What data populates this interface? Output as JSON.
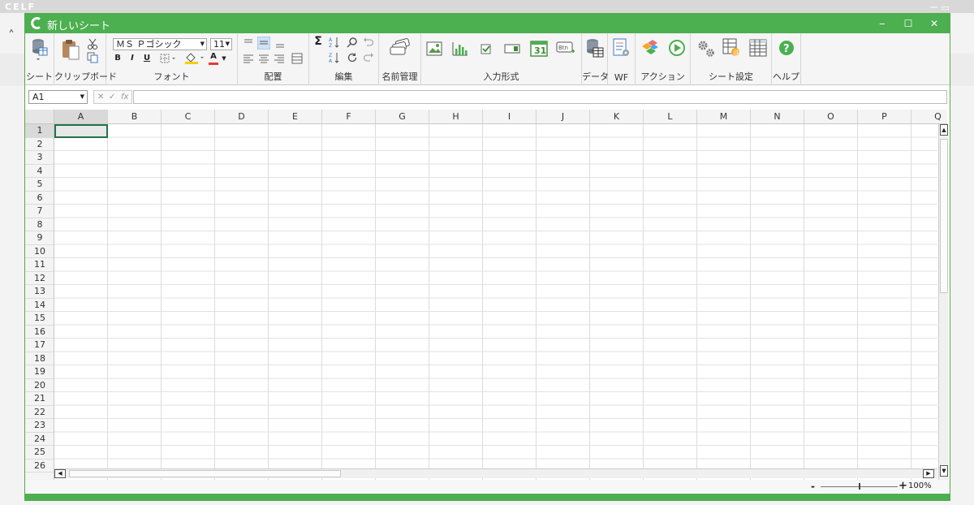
{
  "background_app": {
    "logo_text": "CELF",
    "window_controls": "ー  ▭"
  },
  "window": {
    "title": "新しいシート",
    "controls": {
      "minimize": "‒",
      "maximize": "☐",
      "close": "✕"
    }
  },
  "ribbon": {
    "groups": {
      "sheet": "シート",
      "clipboard": "クリップボード",
      "font": "フォント",
      "alignment": "配置",
      "edit": "編集",
      "name_manager": "名前管理",
      "input_format": "入力形式",
      "data": "データ",
      "wf": "WF",
      "action": "アクション",
      "sheet_settings": "シート設定",
      "help": "ヘルプ"
    },
    "font": {
      "name": "ＭＳ Ｐゴシック",
      "size": "11",
      "bold": "B",
      "italic": "I",
      "underline": "U",
      "font_color_letter": "A",
      "font_color": "#e53935",
      "fill_color": "#f4d000"
    },
    "input_format": {
      "calendar_day": "31",
      "button_label": "Btn"
    }
  },
  "formula_bar": {
    "cell_reference": "A1",
    "cancel": "✕",
    "enter": "✓",
    "fx": "fx",
    "formula": ""
  },
  "grid": {
    "columns": [
      "A",
      "B",
      "C",
      "D",
      "E",
      "F",
      "G",
      "H",
      "I",
      "J",
      "K",
      "L",
      "M",
      "N",
      "O",
      "P",
      "Q"
    ],
    "rows": [
      "1",
      "2",
      "3",
      "4",
      "5",
      "6",
      "7",
      "8",
      "9",
      "10",
      "11",
      "12",
      "13",
      "14",
      "15",
      "16",
      "17",
      "18",
      "19",
      "20",
      "21",
      "22",
      "23",
      "24",
      "25",
      "26"
    ],
    "active_cell": "A1"
  },
  "status": {
    "zoom_minus": "-",
    "zoom_plus": "+",
    "zoom": "100%",
    "zoom_level": 0.5
  },
  "colors": {
    "accent": "#4caf50",
    "active_cell_border": "#217346"
  }
}
